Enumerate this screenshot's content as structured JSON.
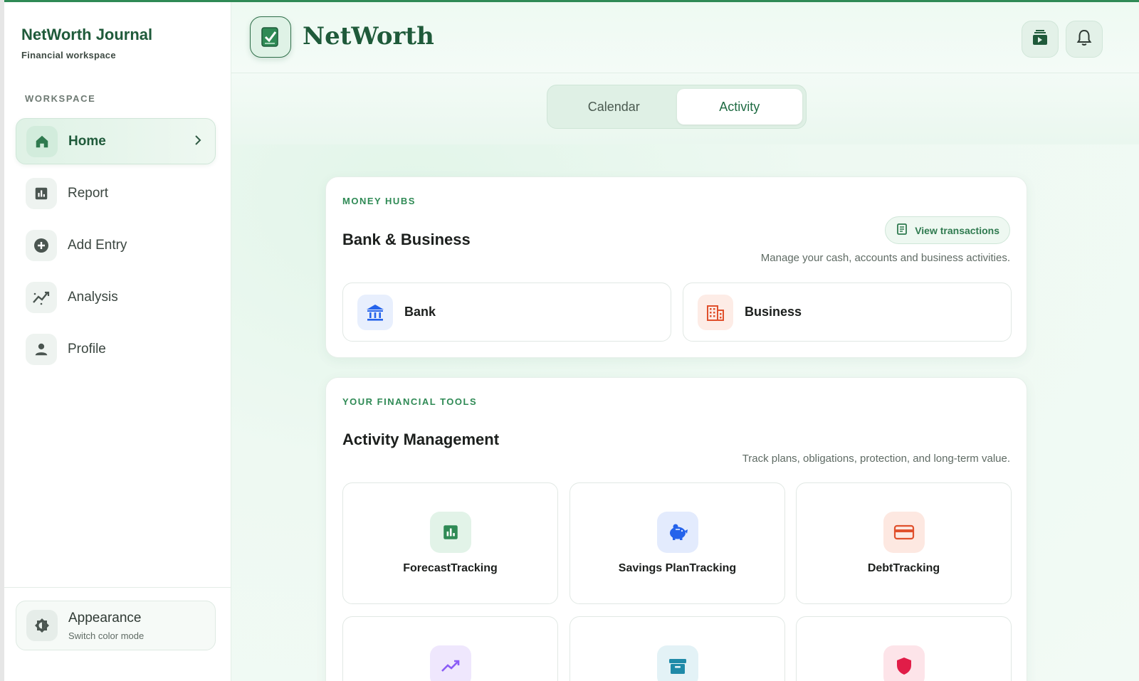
{
  "sidebar": {
    "brand_title": "NetWorth Journal",
    "brand_subtitle": "Financial workspace",
    "section_label": "WORKSPACE",
    "items": [
      {
        "label": "Home",
        "icon": "home-icon",
        "active": true
      },
      {
        "label": "Report",
        "icon": "bar-chart-icon"
      },
      {
        "label": "Add Entry",
        "icon": "plus-circle-icon"
      },
      {
        "label": "Analysis",
        "icon": "trend-icon"
      },
      {
        "label": "Profile",
        "icon": "person-icon"
      }
    ],
    "appearance": {
      "title": "Appearance",
      "subtitle": "Switch color mode",
      "icon": "brightness-icon"
    }
  },
  "header": {
    "logo_text": "NetWorth",
    "logo_icon": "checklist-icon",
    "buttons": [
      {
        "icon": "wallet-icon"
      },
      {
        "icon": "bell-icon"
      }
    ]
  },
  "tabs": {
    "items": [
      {
        "label": "Calendar"
      },
      {
        "label": "Activity",
        "active": true
      }
    ]
  },
  "money_hubs": {
    "eyebrow": "MONEY HUBS",
    "title": "Bank & Business",
    "description": "Manage your cash, accounts and business activities.",
    "view_button": "View transactions",
    "hubs": [
      {
        "label": "Bank",
        "icon": "bank-icon",
        "color": "#2563eb"
      },
      {
        "label": "Business",
        "icon": "building-icon",
        "color": "#e0502c"
      }
    ]
  },
  "tools": {
    "eyebrow": "YOUR FINANCIAL TOOLS",
    "title": "Activity Management",
    "description": "Track plans, obligations, protection, and long-term value.",
    "items": [
      {
        "label": "ForecastTracking",
        "icon": "forecast-icon",
        "color": "#2f8a55"
      },
      {
        "label": "Savings PlanTracking",
        "icon": "piggy-bank-icon",
        "color": "#2563eb"
      },
      {
        "label": "DebtTracking",
        "icon": "credit-card-icon",
        "color": "#e0502c"
      },
      {
        "label": "",
        "icon": "trending-up-icon",
        "color": "#8b5cf6"
      },
      {
        "label": "",
        "icon": "archive-icon",
        "color": "#1f8aa8"
      },
      {
        "label": "",
        "icon": "shield-icon",
        "color": "#e11d48"
      }
    ]
  },
  "colors": {
    "accent": "#2f8a55",
    "brand": "#1f5a3a"
  }
}
